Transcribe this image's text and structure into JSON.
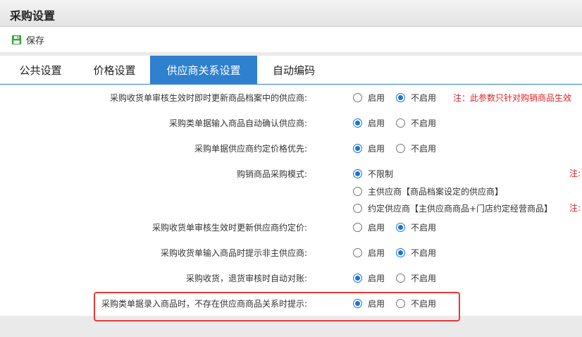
{
  "window": {
    "title": "采购设置"
  },
  "toolbar": {
    "save_label": "保存"
  },
  "tabs": [
    {
      "label": "公共设置"
    },
    {
      "label": "价格设置"
    },
    {
      "label": "供应商关系设置",
      "active": true
    },
    {
      "label": "自动编码"
    }
  ],
  "settings": [
    {
      "label": "采购收货单审核生效时即时更新商品档案中的供应商:",
      "options": [
        "启用",
        "不启用"
      ],
      "selected": "不启用",
      "note": "注：此参数只针对购销商品生效"
    },
    {
      "label": "采购类单据输入商品自动确认供应商:",
      "options": [
        "启用",
        "不启用"
      ],
      "selected": "启用"
    },
    {
      "label": "采购单据供应商约定价格优先:",
      "options": [
        "启用",
        "不启用"
      ],
      "selected": "启用"
    },
    {
      "label": "购销商品采购模式:",
      "options": [
        "不限制",
        "主供应商【商品档案设定的供应商】",
        "约定供应商【主供应商商品+门店约定经营商品】"
      ],
      "selected": "不限制",
      "notes": [
        "注:",
        "注:"
      ]
    },
    {
      "label": "采购收货单审核生效时更新供应商约定价:",
      "options": [
        "启用",
        "不启用"
      ],
      "selected": "不启用"
    },
    {
      "label": "采购收货单输入商品时提示非主供应商:",
      "options": [
        "启用",
        "不启用"
      ],
      "selected": "不启用"
    },
    {
      "label": "采购收货，退货审核时自动对账:",
      "options": [
        "启用",
        "不启用"
      ],
      "selected": "启用"
    },
    {
      "label": "采购类单据录入商品时，不存在供应商商品关系时提示:",
      "options": [
        "启用",
        "不启用"
      ],
      "selected": "启用"
    }
  ],
  "colors": {
    "accent": "#2f80ce",
    "radio": "#1a73d9",
    "note": "#e02020",
    "highlight": "#e53935"
  }
}
